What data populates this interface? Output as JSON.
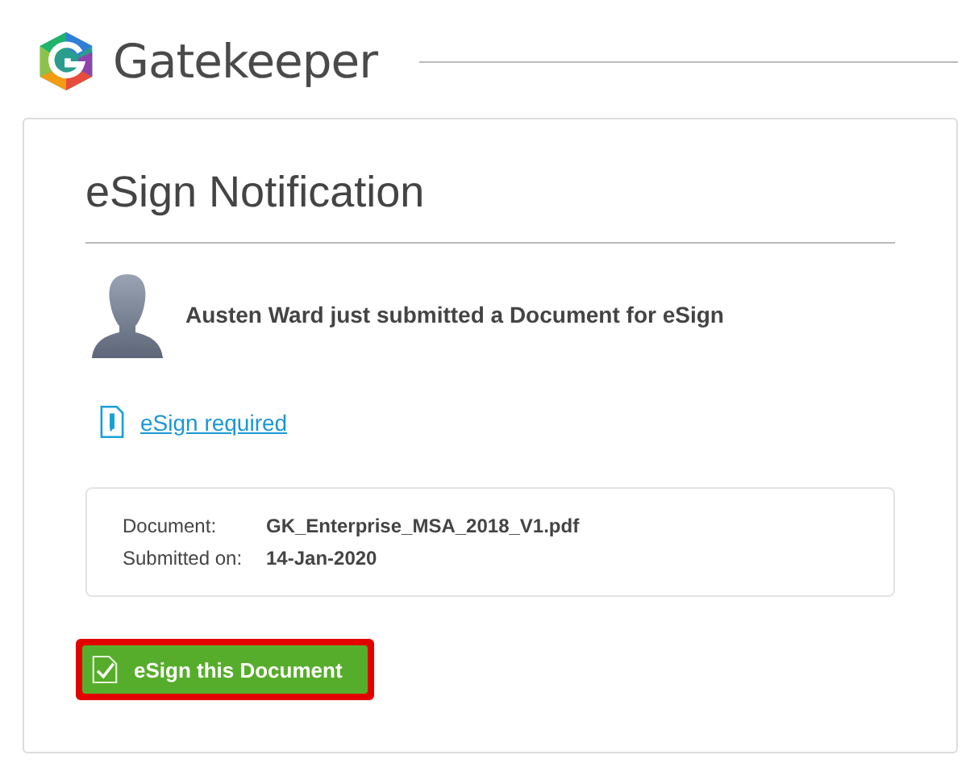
{
  "header": {
    "brand": "Gatekeeper"
  },
  "card": {
    "title": "eSign Notification",
    "message": "Austen Ward just submitted a Document for eSign",
    "link": "eSign required",
    "details": [
      {
        "label": "Document:",
        "value": "GK_Enterprise_MSA_2018_V1.pdf"
      },
      {
        "label": "Submitted on:",
        "value": "14-Jan-2020"
      }
    ],
    "button": {
      "label": "eSign this Document",
      "highlighted": true
    }
  }
}
